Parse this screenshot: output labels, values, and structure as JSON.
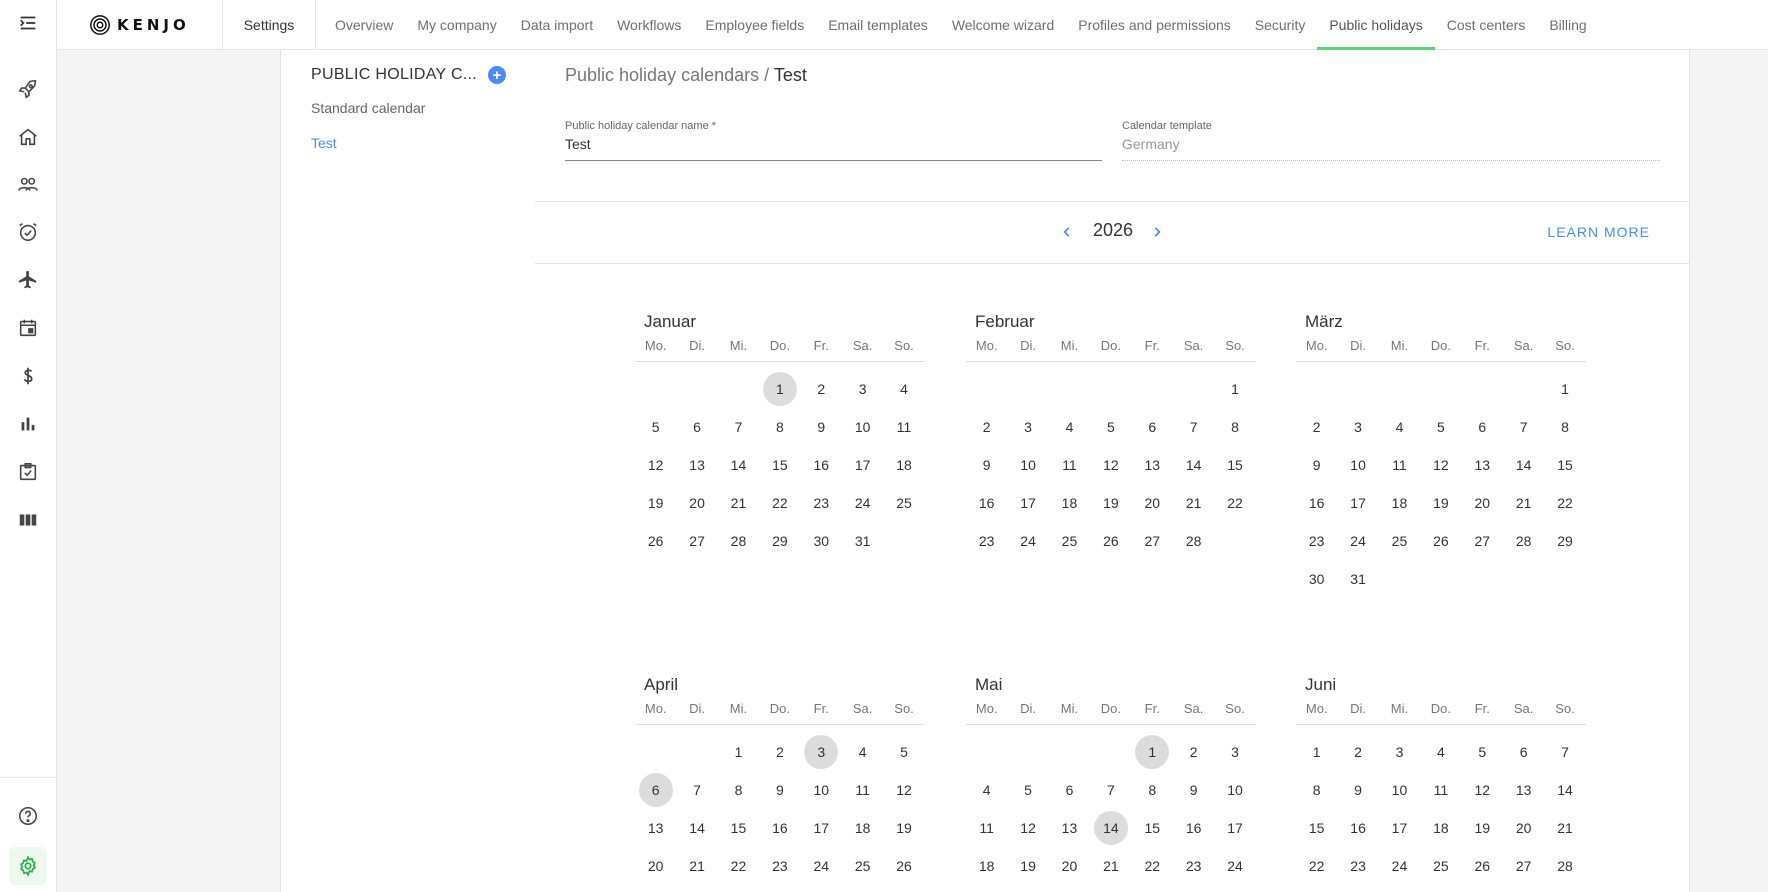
{
  "rail": {
    "icons": [
      "menu-collapse-icon",
      "rocket-icon",
      "home-icon",
      "people-icon",
      "alarm-check-icon",
      "plane-icon",
      "calendar-icon",
      "dollar-icon",
      "bar-chart-icon",
      "checklist-icon",
      "columns-icon",
      "help-icon",
      "gear-icon"
    ]
  },
  "topbar": {
    "logo_text": "KENJO",
    "settings_label": "Settings",
    "tabs": [
      "Overview",
      "My company",
      "Data import",
      "Workflows",
      "Employee fields",
      "Email templates",
      "Welcome wizard",
      "Profiles and permissions",
      "Security",
      "Public holidays",
      "Cost centers",
      "Billing"
    ],
    "active_tab": "Public holidays"
  },
  "list": {
    "header": "PUBLIC HOLIDAY C...",
    "add_symbol": "+",
    "items": [
      "Standard calendar",
      "Test"
    ],
    "selected": "Test"
  },
  "main": {
    "breadcrumb_parent": "Public holiday calendars",
    "breadcrumb_sep": " / ",
    "breadcrumb_current": "Test",
    "name_label": "Public holiday calendar name *",
    "name_value": "Test",
    "template_label": "Calendar template",
    "template_value": "Germany",
    "year": "2026",
    "learn_more": "LEARN MORE"
  },
  "calendar": {
    "weekdays": [
      "Mo.",
      "Di.",
      "Mi.",
      "Do.",
      "Fr.",
      "Sa.",
      "So."
    ],
    "months": [
      {
        "name": "Januar",
        "offset": 3,
        "days": 31,
        "holidays": [
          1
        ]
      },
      {
        "name": "Februar",
        "offset": 6,
        "days": 28,
        "holidays": []
      },
      {
        "name": "März",
        "offset": 6,
        "days": 31,
        "holidays": []
      },
      {
        "name": "April",
        "offset": 2,
        "days": 26,
        "holidays": [
          3,
          6
        ]
      },
      {
        "name": "Mai",
        "offset": 4,
        "days": 24,
        "holidays": [
          1,
          14
        ]
      },
      {
        "name": "Juni",
        "offset": 0,
        "days": 28,
        "holidays": []
      }
    ]
  }
}
